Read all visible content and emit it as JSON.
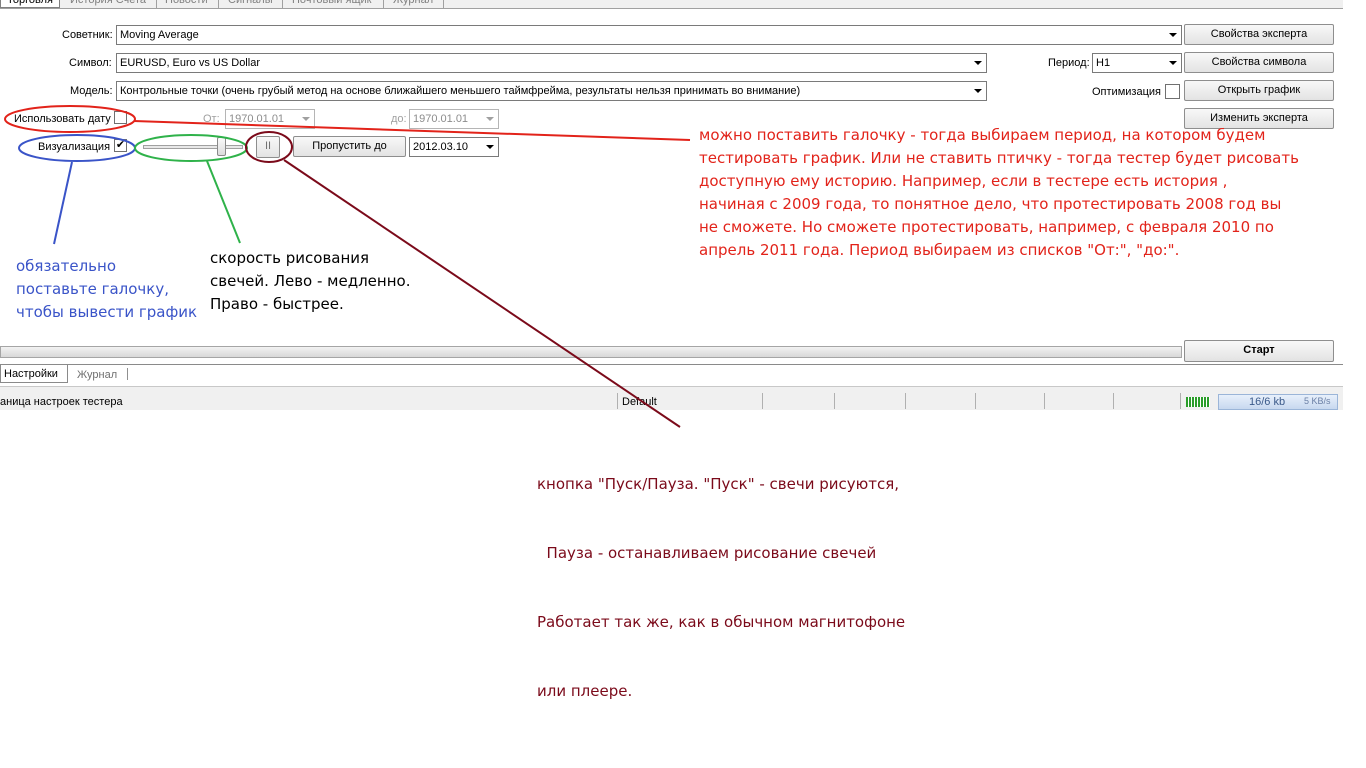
{
  "top_tabs": [
    "Торговля",
    "История Счета",
    "Новости",
    "Сигналы",
    "Почтовый ящик",
    "Журнал"
  ],
  "form": {
    "expert_label": "Советник:",
    "expert_value": "Moving Average",
    "expert_props_button": "Свойства эксперта",
    "symbol_label": "Символ:",
    "symbol_value": "EURUSD, Euro vs US Dollar",
    "period_label": "Период:",
    "period_value": "H1",
    "symbol_props_button": "Свойства символа",
    "model_label": "Модель:",
    "model_value": "Контрольные точки (очень грубый метод на основе ближайшего меньшего таймфрейма, результаты нельзя принимать во внимание)",
    "optimization_label": "Оптимизация",
    "open_chart_button": "Открыть график",
    "use_date_label": "Использовать дату",
    "from_label": "От:",
    "from_value": "1970.01.01",
    "to_label": "до:",
    "to_value": "1970.01.01",
    "modify_expert_button": "Изменить эксперта",
    "visualization_label": "Визуализация",
    "visualization_checked": "✔",
    "pause_glyph": "II",
    "skip_to_button": "Пропустить до",
    "skip_to_value": "2012.03.10",
    "start_button": "Старт"
  },
  "bottom_tabs": [
    "Настройки",
    "Журнал"
  ],
  "status": {
    "text": "аница настроек тестера",
    "profile": "Default",
    "traffic": "16/6 kb",
    "speed": "5 KB/s"
  },
  "annotations": {
    "red": [
      "можно поставить галочку - тогда выбираем период, на котором будем",
      "тестировать график. Или не ставить птичку - тогда тестер будет рисовать",
      "доступную ему историю. Например, если в тестере есть история ,",
      "начиная с 2009 года, то понятное дело, что протестировать 2008 год вы",
      "не сможете. Но сможете протестировать, например, с февраля 2010 по",
      "апрель 2011 года. Период выбираем из списков \"От:\", \"до:\"."
    ],
    "blue": [
      "обязательно",
      "поставьте галочку,",
      "чтобы вывести график"
    ],
    "black": [
      "скорость рисования",
      "свечей. Лево - медленно.",
      "Право - быстрее."
    ],
    "dark": [
      "кнопка \"Пуск/Пауза. \"Пуск\" - свечи рисуются,",
      "  Пауза - останавливаем рисование свечей",
      "Работает так же, как в обычном магнитофоне",
      "или плеере."
    ]
  },
  "colors": {
    "red": "#e2231a",
    "blue": "#3a54c8",
    "green": "#2fb24a",
    "dark": "#7b0a1a"
  }
}
